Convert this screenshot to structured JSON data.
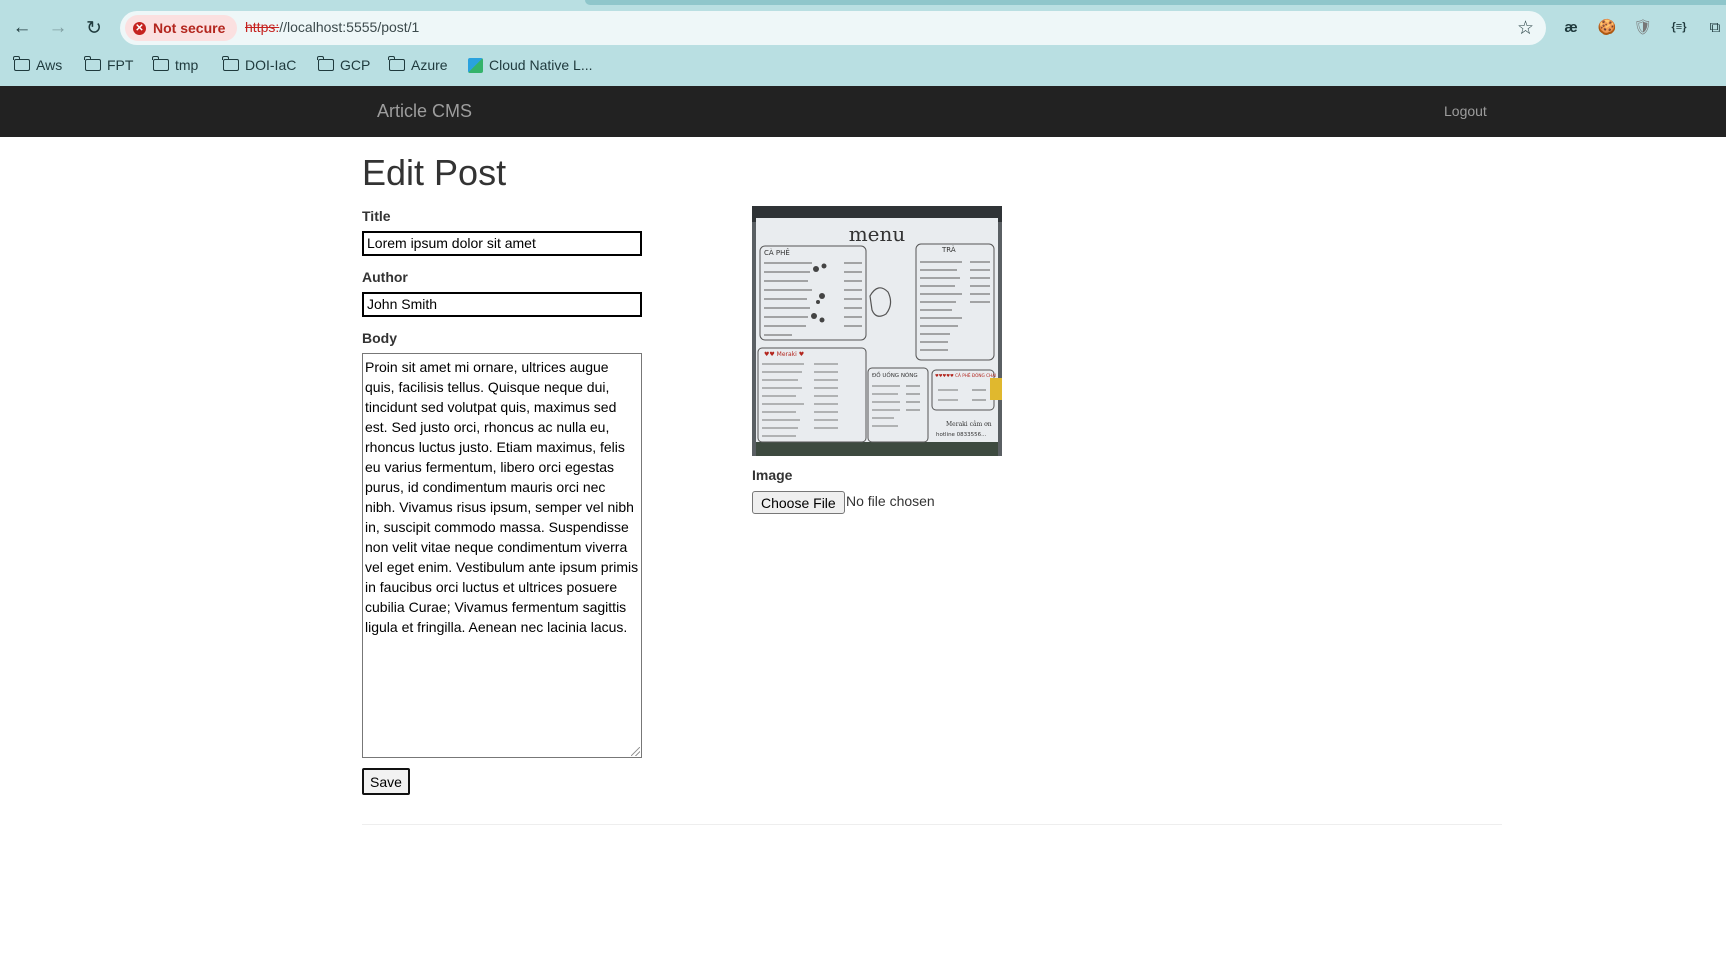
{
  "browser": {
    "security_label": "Not secure",
    "url_scheme": "https:",
    "url_rest": "//localhost:5555/post/1",
    "bookmarks": [
      "Aws",
      "FPT",
      "tmp",
      "DOI-IaC",
      "GCP",
      "Azure",
      "Cloud Native L..."
    ],
    "extensions": [
      "æ",
      "🍪",
      "🛡",
      "{≡}",
      "⧉"
    ]
  },
  "navbar": {
    "brand": "Article CMS",
    "logout": "Logout"
  },
  "form": {
    "heading": "Edit Post",
    "title_label": "Title",
    "title_value": "Lorem ipsum dolor sit amet",
    "author_label": "Author",
    "author_value": "John Smith",
    "body_label": "Body",
    "body_value": "Proin sit amet mi ornare, ultrices augue quis, facilisis tellus. Quisque neque dui, tincidunt sed volutpat quis, maximus sed est. Sed justo orci, rhoncus ac nulla eu, rhoncus luctus justo. Etiam maximus, felis eu varius fermentum, libero orci egestas purus, id condimentum mauris orci nec nibh. Vivamus risus ipsum, semper vel nibh in, suscipit commodo massa. Suspendisse non velit vitae neque condimentum viverra vel eget enim. Vestibulum ante ipsum primis in faucibus orci luctus et ultrices posuere cubilia Curae; Vivamus fermentum sagittis ligula et fringilla. Aenean nec lacinia lacus.",
    "save_label": "Save",
    "image_label": "Image",
    "choose_file_label": "Choose File",
    "file_status": "No file chosen"
  },
  "preview_image": {
    "heading": "menu",
    "section_coffee": "CÀ PHÊ",
    "section_tea": "TRÀ",
    "section_meraki": "♥♥ Meraki ♥",
    "section_hot": "ĐỒ UỐNG NÓNG",
    "section_special": "♥♥♥♥♥ CÀ PHÊ ĐÓNG CHAI",
    "signature": "Meraki cảm ơn",
    "hotline": "hotline 0833556..."
  }
}
